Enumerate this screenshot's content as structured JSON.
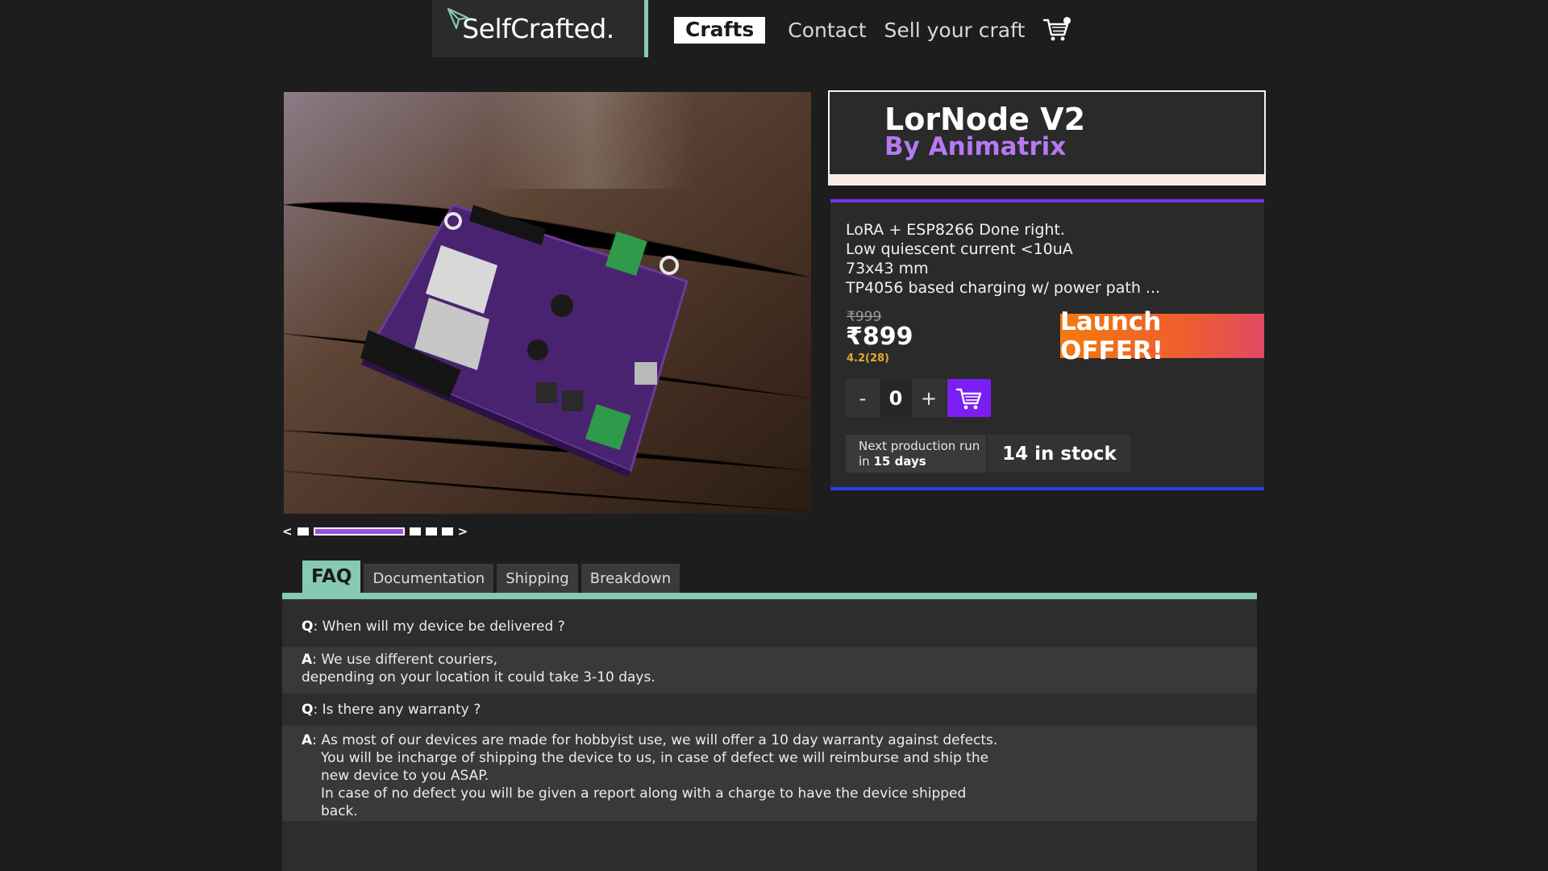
{
  "header": {
    "logo_text": "SelfCrafted.",
    "nav": {
      "crafts": "Crafts",
      "contact": "Contact",
      "sell": "Sell your craft"
    }
  },
  "product": {
    "title": "LorNode V2",
    "author": "By Animatrix",
    "features": [
      "LoRA + ESP8266 Done right.",
      "Low quiescent current <10uA",
      "73x43 mm",
      "TP4056 based charging w/ power path ..."
    ],
    "old_price": "₹999",
    "price": "₹899",
    "rating": "4.2(28)",
    "offer": "Launch OFFER!",
    "quantity": "0",
    "qty_minus": "-",
    "qty_plus": "+",
    "next_run_label": "Next production run",
    "next_run_prefix": "in",
    "next_run_value": "15 days",
    "stock": "14 in stock"
  },
  "carousel": {
    "prev": "<",
    "next": ">",
    "slide_count": 5,
    "active_index": 1
  },
  "tabs": [
    "FAQ",
    "Documentation",
    "Shipping",
    "Breakdown"
  ],
  "faq": {
    "q_marker": "Q",
    "a_marker": "A",
    "items": [
      {
        "q": "When will my device be delivered ?",
        "a": [
          "We use different couriers,",
          "depending on your location it could take 3-10 days."
        ]
      },
      {
        "q": "Is there any warranty ?",
        "a": [
          "As most of our devices are made for hobbyist use, we will offer a 10 day warranty against defects.",
          "You will be incharge of shipping the device to us, in case of defect we will reimburse and ship the",
          "new device to you ASAP.",
          "In case of no defect you will be given a report along with a charge to have the device shipped",
          "back."
        ]
      }
    ]
  },
  "colors": {
    "accent_teal": "#86c9b4",
    "accent_purple": "#7b1ef4",
    "author_purple": "#b579f2",
    "offer_orange": "#f4790f",
    "rating_orange": "#e8a82f"
  }
}
